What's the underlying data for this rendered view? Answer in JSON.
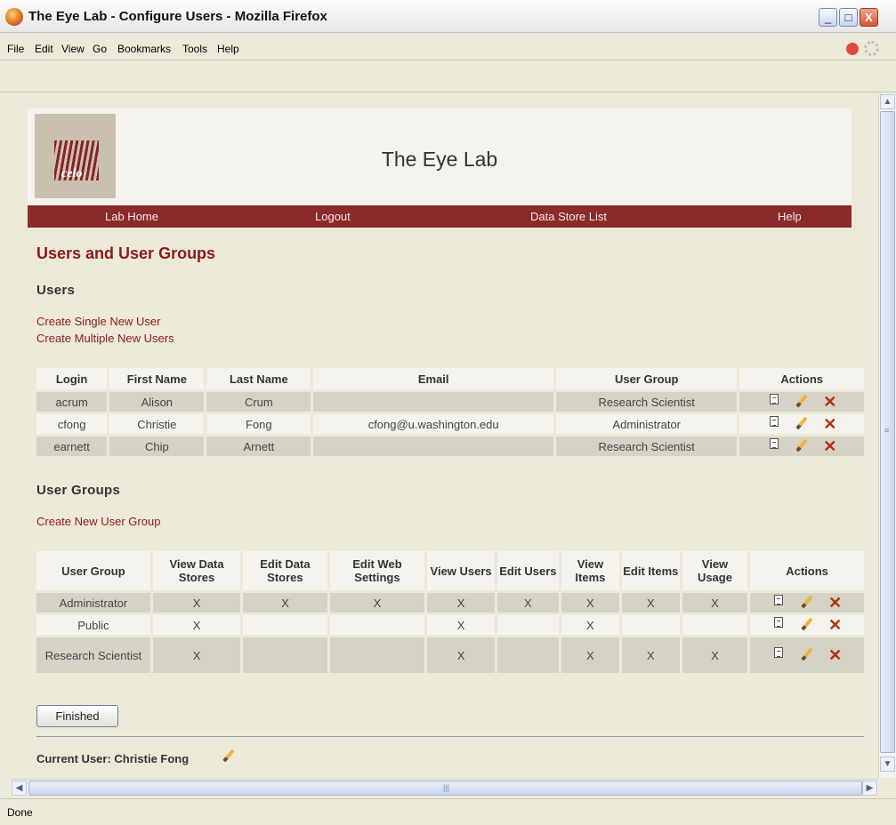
{
  "window": {
    "title": "The Eye Lab - Configure Users - Mozilla Firefox",
    "min": "_",
    "max": "□",
    "close": "X"
  },
  "menu": [
    "File",
    "Edit",
    "View",
    "Go",
    "Bookmarks",
    "Tools",
    "Help"
  ],
  "status": "Done",
  "site": {
    "title": "The Eye Lab",
    "logo_text": "celo"
  },
  "nav": [
    "Lab Home",
    "Logout",
    "Data Store List",
    "Help"
  ],
  "page_heading": "Users and User Groups",
  "users": {
    "heading": "Users",
    "links": [
      "Create Single New User",
      "Create Multiple New Users"
    ],
    "columns": [
      "Login",
      "First Name",
      "Last Name",
      "Email",
      "User Group",
      "Actions"
    ],
    "rows": [
      {
        "login": "acrum",
        "first": "Alison",
        "last": "Crum",
        "email": "",
        "group": "Research Scientist"
      },
      {
        "login": "cfong",
        "first": "Christie",
        "last": "Fong",
        "email": "cfong@u.washington.edu",
        "group": "Administrator"
      },
      {
        "login": "earnett",
        "first": "Chip",
        "last": "Arnett",
        "email": "",
        "group": "Research Scientist"
      }
    ]
  },
  "groups": {
    "heading": "User Groups",
    "link": "Create New User Group",
    "columns": [
      "User Group",
      "View Data Stores",
      "Edit Data Stores",
      "Edit Web Settings",
      "View Users",
      "Edit Users",
      "View Items",
      "Edit Items",
      "View Usage",
      "Actions"
    ],
    "rows": [
      {
        "name": "Administrator",
        "perms": [
          "X",
          "X",
          "X",
          "X",
          "X",
          "X",
          "X",
          "X"
        ]
      },
      {
        "name": "Public",
        "perms": [
          "X",
          "",
          "",
          "X",
          "",
          "X",
          "",
          ""
        ]
      },
      {
        "name": "Research Scientist",
        "perms": [
          "X",
          "",
          "",
          "X",
          "",
          "X",
          "X",
          "X"
        ]
      }
    ]
  },
  "finished_label": "Finished",
  "current_user": "Current User: Christie Fong"
}
